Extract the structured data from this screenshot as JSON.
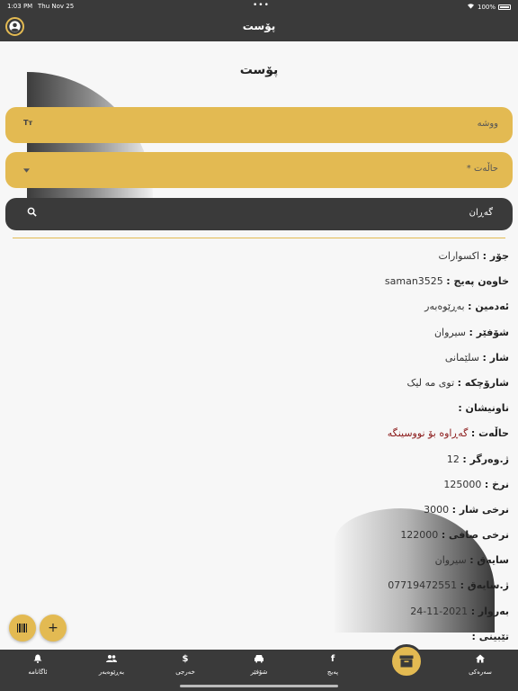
{
  "status": {
    "time": "1:03 PM",
    "date": "Thu Nov 25",
    "battery": "100%"
  },
  "appbar": {
    "title": "پۆست"
  },
  "page": {
    "heading": "پۆست"
  },
  "form": {
    "word_label": "ووشە",
    "word_icon": "Tт",
    "status_label": "* حاڵەت",
    "search_label": "گەڕان"
  },
  "details": [
    {
      "key": "جۆر :",
      "value": "اکسوارات"
    },
    {
      "key": "خاوەن پەیج :",
      "value": "saman3525"
    },
    {
      "key": "ئەدمین :",
      "value": "بەڕێوەبەر"
    },
    {
      "key": "شۆفێر :",
      "value": "سیروان"
    },
    {
      "key": "شار :",
      "value": "سلێمانی"
    },
    {
      "key": "شارۆچکە :",
      "value": "توی مە لیک"
    },
    {
      "key": "ناونیشان :",
      "value": ""
    },
    {
      "key": "حاڵەت :",
      "value": "گەڕاوە بۆ نووسینگە"
    },
    {
      "key": "ژ.وەرگر :",
      "value": "12"
    },
    {
      "key": "نرخ :",
      "value": "125000"
    },
    {
      "key": "نرخی شار :",
      "value": "3000"
    },
    {
      "key": "نرخی صافی :",
      "value": "122000"
    },
    {
      "key": "سایەق :",
      "value": "سیروان"
    },
    {
      "key": "ژ.سایەق :",
      "value": "07719472551"
    },
    {
      "key": "بەروار :",
      "value": "2021-11-24"
    },
    {
      "key": "تێبینی :",
      "value": ""
    }
  ],
  "nav": {
    "home": "سەرەکی",
    "page": "پەیج",
    "driver": "شۆفێر",
    "expense": "خەرجی",
    "manager": "بەڕێوەبەر",
    "notifications": "ئاگانامە"
  },
  "colors": {
    "accent": "#e3ba52",
    "dark": "#3a3a3a",
    "status_value": "#8b1a1a"
  }
}
